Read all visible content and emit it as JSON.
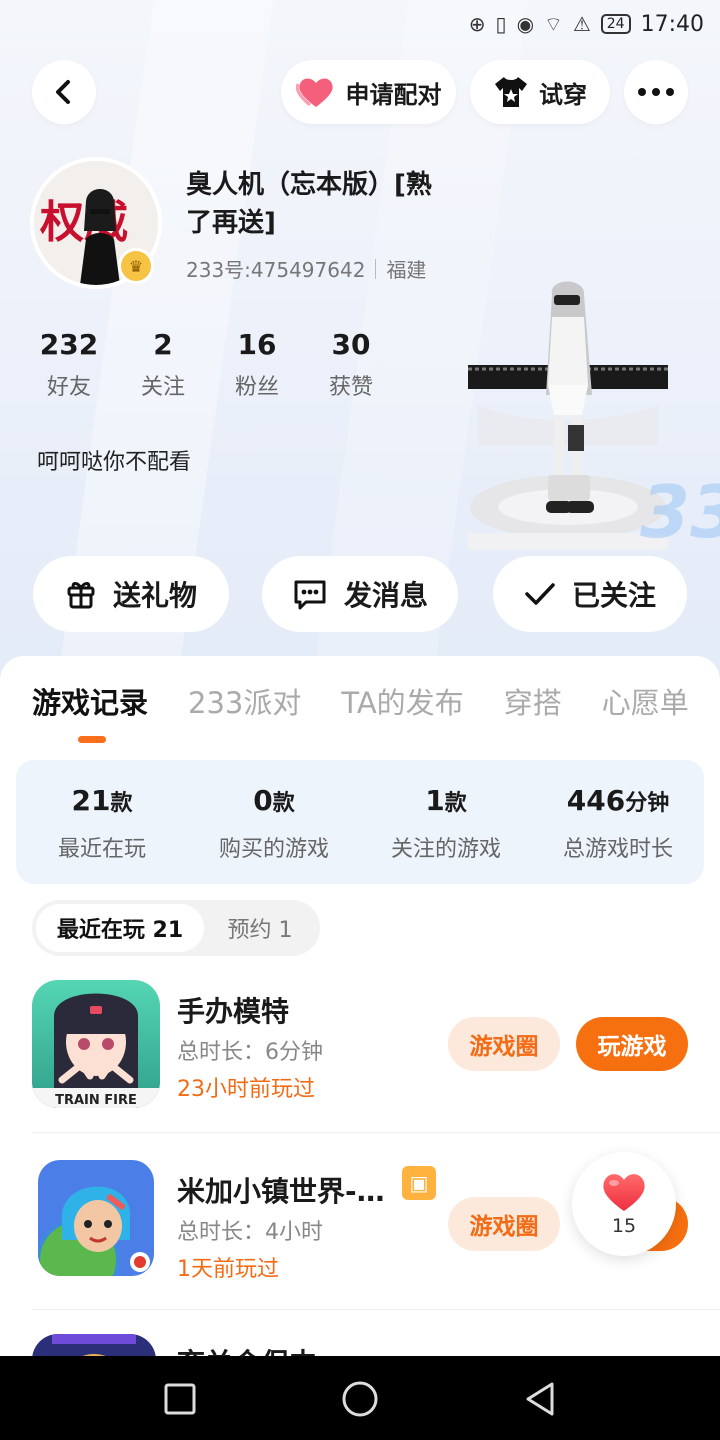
{
  "status_bar": {
    "battery": "24",
    "time": "17:40"
  },
  "header": {
    "pair_label": "申请配对",
    "try_label": "试穿"
  },
  "profile": {
    "name": "臭人机（忘本版）[熟了再送]",
    "uid": "233号:475497642",
    "location": "福建",
    "bio": "呵呵哒你不配看",
    "avatar_text": "权威",
    "stats": [
      {
        "num": "232",
        "label": "好友"
      },
      {
        "num": "2",
        "label": "关注"
      },
      {
        "num": "16",
        "label": "粉丝"
      },
      {
        "num": "30",
        "label": "获赞"
      }
    ]
  },
  "actions": {
    "gift": "送礼物",
    "message": "发消息",
    "followed": "已关注"
  },
  "tabs": [
    "游戏记录",
    "233派对",
    "TA的发布",
    "穿搭",
    "心愿单"
  ],
  "summary": [
    {
      "value": "21",
      "unit": "款",
      "label": "最近在玩"
    },
    {
      "value": "0",
      "unit": "款",
      "label": "购买的游戏"
    },
    {
      "value": "1",
      "unit": "款",
      "label": "关注的游戏"
    },
    {
      "value": "446",
      "unit": "分钟",
      "label": "总游戏时长"
    }
  ],
  "subtabs": {
    "recent": "最近在玩 21",
    "reserve": "预约 1"
  },
  "games": [
    {
      "name": "手办模特",
      "time": "总时长：6分钟",
      "last": "23小时前玩过",
      "icon_text": "TRAIN FIRE",
      "circle": "游戏圈",
      "play": "玩游戏"
    },
    {
      "name": "米加小镇世界-…",
      "time": "总时长：4小时",
      "last": "1天前玩过",
      "circle": "游戏圈"
    },
    {
      "name": "弃关会保中"
    }
  ],
  "like_count": "15",
  "colors": {
    "accent": "#f7700f",
    "accent_light": "#fde8dc",
    "summary_bg": "#eef4fc"
  }
}
